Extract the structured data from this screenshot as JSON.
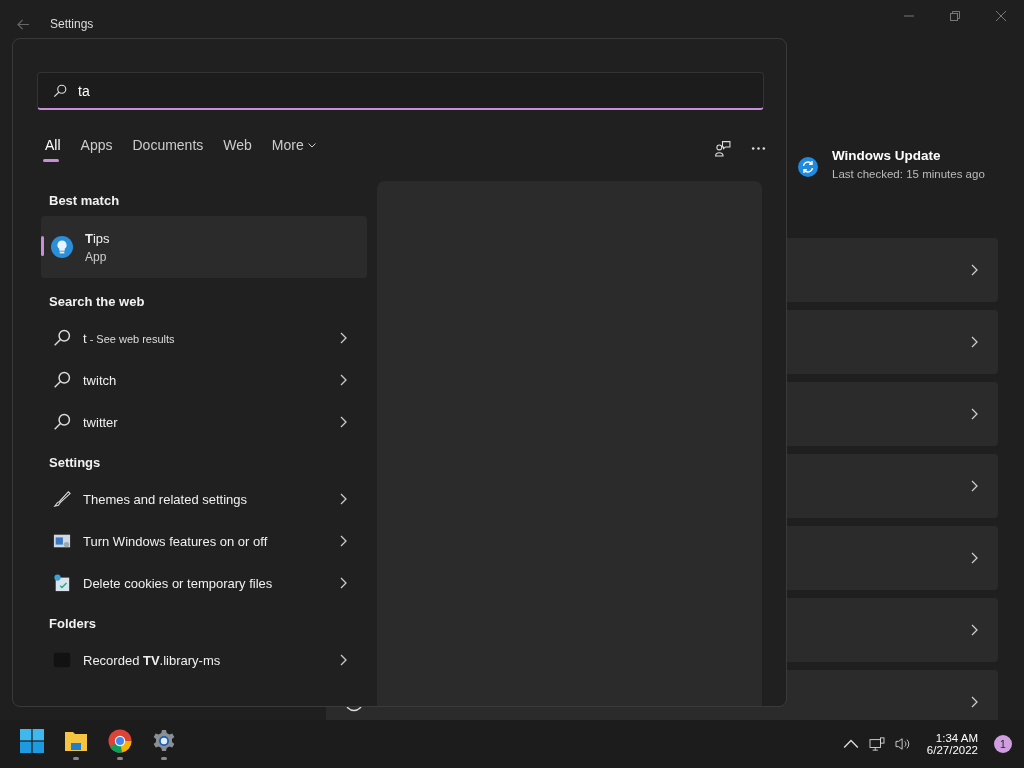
{
  "settings_window": {
    "title": "Settings",
    "update": {
      "title": "Windows Update",
      "subtitle": "Last checked: 15 minutes ago"
    }
  },
  "search": {
    "query": "ta",
    "filters": [
      {
        "label": "All",
        "selected": true
      },
      {
        "label": "Apps",
        "selected": false
      },
      {
        "label": "Documents",
        "selected": false
      },
      {
        "label": "Web",
        "selected": false
      },
      {
        "label": "More",
        "selected": false
      }
    ],
    "sections": [
      {
        "heading": "Best match",
        "kind": "best",
        "items": [
          {
            "title": "**T**ips",
            "subtitle": "App",
            "selected": true
          }
        ]
      },
      {
        "heading": "Search the web",
        "kind": "web",
        "items": [
          {
            "title": "t",
            "hint": "- See web results",
            "selected": false
          },
          {
            "title": "twitch",
            "selected": false
          },
          {
            "title": "twitter",
            "selected": false
          }
        ]
      },
      {
        "heading": "Settings",
        "kind": "settings",
        "items": [
          {
            "title": "Themes and related settings",
            "selected": false
          },
          {
            "title": "Turn Windows features on or off",
            "selected": false
          },
          {
            "title": "Delete cookies or temporary files",
            "selected": false
          }
        ]
      },
      {
        "heading": "Folders",
        "kind": "folders",
        "items": [
          {
            "title": "Recorded **TV**.library-ms",
            "selected": false
          }
        ]
      }
    ]
  },
  "taskbar": {
    "apps": [
      {
        "kind": "start",
        "running": false
      },
      {
        "kind": "explorer",
        "running": true
      },
      {
        "kind": "chrome",
        "running": true
      },
      {
        "kind": "settings",
        "running": true
      }
    ],
    "time": "1:34 AM",
    "date": "6/27/2022",
    "notifications": "1"
  }
}
